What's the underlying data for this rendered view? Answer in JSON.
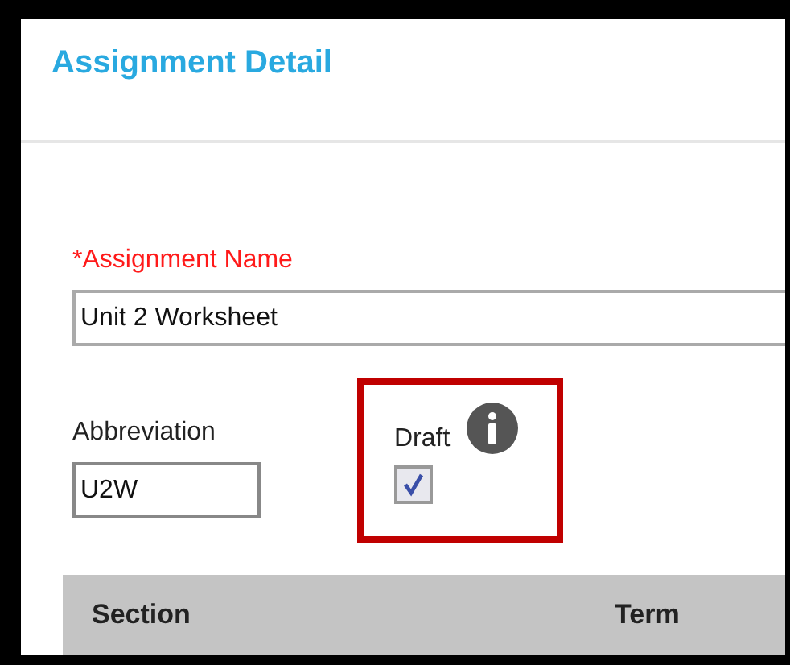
{
  "header": {
    "title": "Assignment Detail"
  },
  "name_field": {
    "label": "*Assignment Name",
    "value": "Unit 2 Worksheet"
  },
  "abbreviation_field": {
    "label": "Abbreviation",
    "value": "U2W"
  },
  "draft": {
    "label": "Draft",
    "checked": true,
    "highlighted": true
  },
  "table": {
    "columns": [
      "Section",
      "Term"
    ]
  }
}
